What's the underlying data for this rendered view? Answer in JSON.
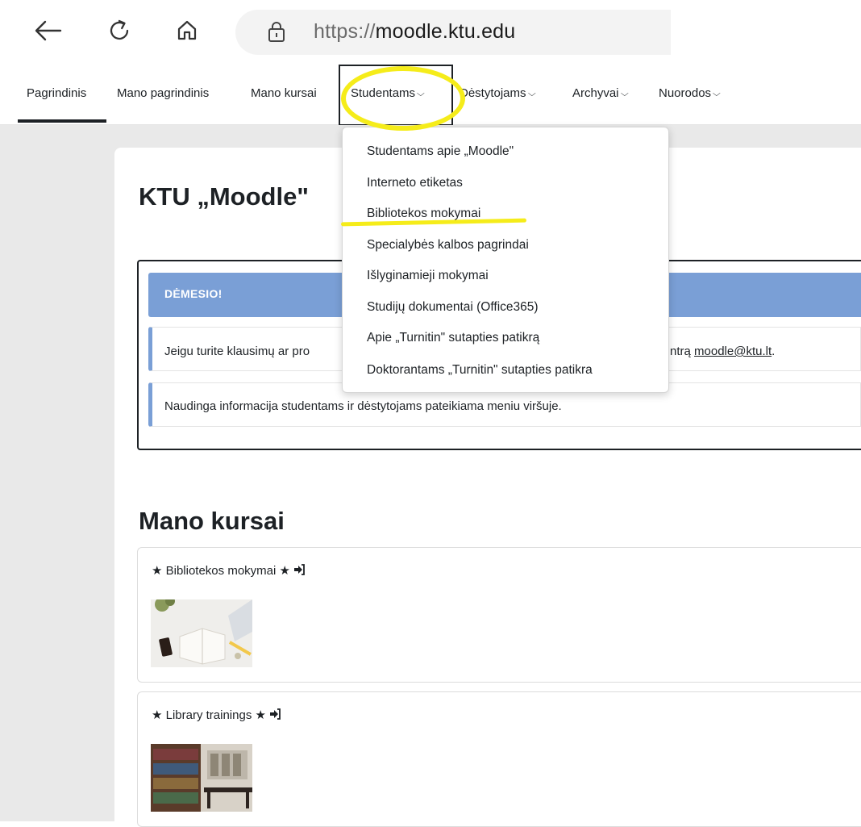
{
  "browser": {
    "url_prefix": "https://",
    "url_host": "moodle.ktu.edu"
  },
  "nav": {
    "items": [
      {
        "label": "Pagrindinis"
      },
      {
        "label": "Mano pagrindinis"
      },
      {
        "label": "Mano kursai"
      },
      {
        "label": "Studentams"
      },
      {
        "label": "Dėstytojams"
      },
      {
        "label": "Archyvai"
      },
      {
        "label": "Nuorodos"
      }
    ],
    "active": "Pagrindinis",
    "chevron": "⌄"
  },
  "dropdown": {
    "items": [
      {
        "label": "Studentams apie „Moodle\""
      },
      {
        "label": "Interneto etiketas"
      },
      {
        "label": "Bibliotekos mokymai"
      },
      {
        "label": "Specialybės kalbos pagrindai"
      },
      {
        "label": "Išlyginamieji mokymai"
      },
      {
        "label": "Studijų dokumentai (Office365)"
      },
      {
        "label": "Apie „Turnitin\" sutapties patikrą"
      },
      {
        "label": "Doktorantams „Turnitin\" sutapties patikra"
      }
    ]
  },
  "page": {
    "title": "KTU „Moodle\"",
    "notice": {
      "header": "DĖMESIO!",
      "line1_start": "Jeigu turite klausimų ar pro",
      "line1_end": "ntrą",
      "line1_link": "moodle@ktu.lt",
      "line1_tail": ".",
      "line2": "Naudinga informacija studentams ir dėstytojams pateikiama meniu viršuje."
    },
    "courses_heading": "Mano kursai",
    "courses": [
      {
        "title": "★ Bibliotekos mokymai ★"
      },
      {
        "title": "★ Library trainings ★"
      }
    ]
  },
  "colors": {
    "accent": "#7a9fd6",
    "annotation": "#f5ec1a",
    "text": "#1d2125"
  }
}
